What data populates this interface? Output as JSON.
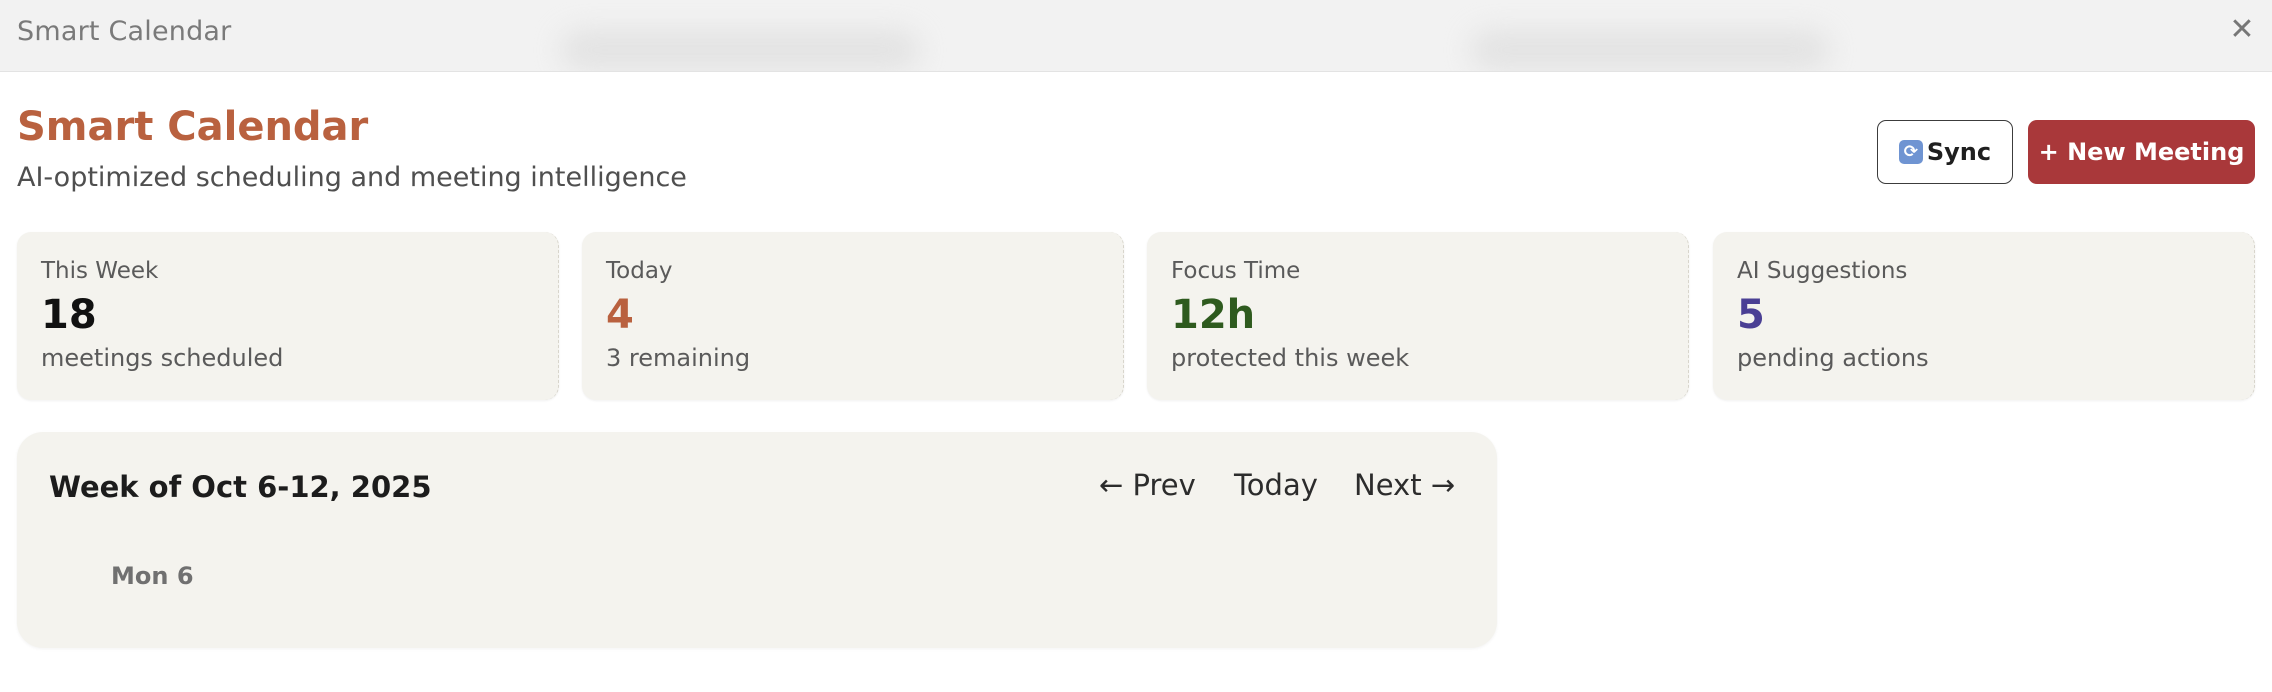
{
  "window": {
    "title": "Smart Calendar",
    "close_icon": "close-icon"
  },
  "header": {
    "title": "Smart Calendar",
    "subtitle": "AI-optimized scheduling and meeting intelligence",
    "sync_label": "Sync",
    "sync_icon": "refresh-icon",
    "new_meeting_label": "+ New Meeting"
  },
  "stats": [
    {
      "label": "This Week",
      "value": "18",
      "sub": "meetings scheduled",
      "color": "#111111"
    },
    {
      "label": "Today",
      "value": "4",
      "sub": "3 remaining",
      "color": "#b9613f"
    },
    {
      "label": "Focus Time",
      "value": "12h",
      "sub": "protected this week",
      "color": "#2e5a1e"
    },
    {
      "label": "AI Suggestions",
      "value": "5",
      "sub": "pending actions",
      "color": "#4a3f94"
    }
  ],
  "calendar": {
    "week_title": "Week of Oct 6-12, 2025",
    "prev_label": "← Prev",
    "today_label": "Today",
    "next_label": "Next →",
    "days": [
      "Mon 6"
    ]
  },
  "colors": {
    "accent": "#b9613f",
    "primary_button": "#a9383a",
    "card_bg": "#f4f3ee"
  }
}
